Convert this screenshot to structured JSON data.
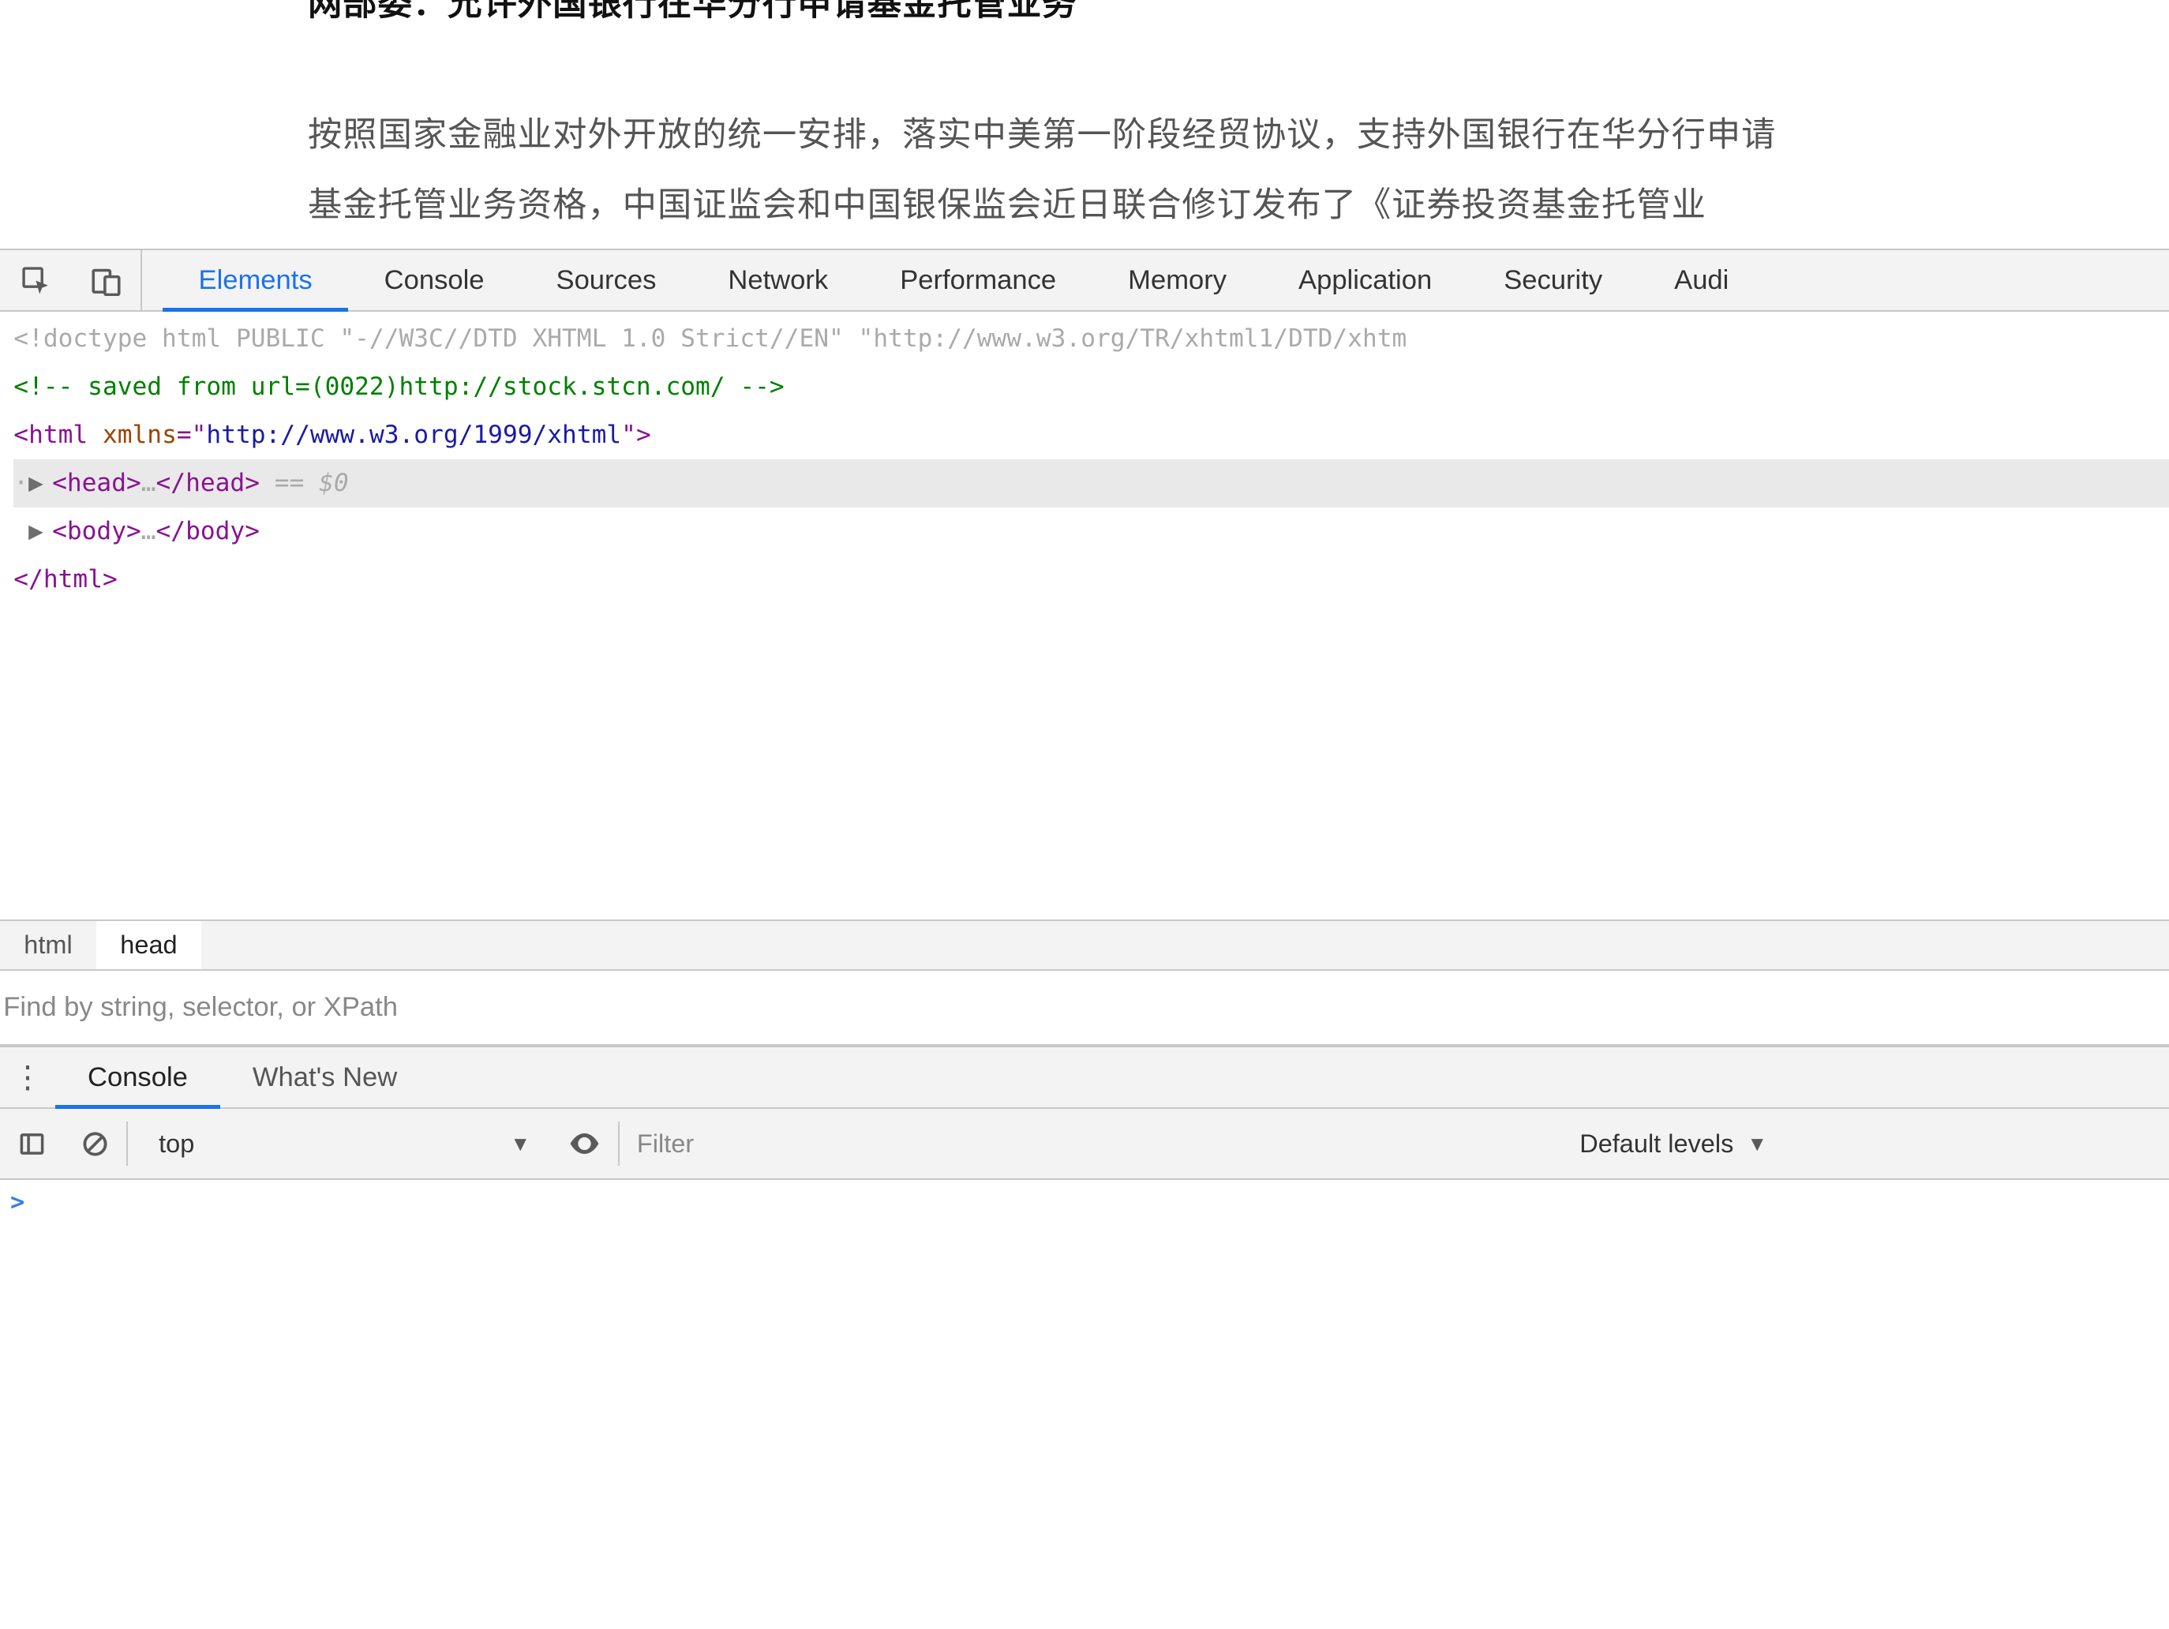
{
  "page": {
    "title": "网部委：允许外国银行在华分行申请基金托管业务",
    "body_line1": "按照国家金融业对外开放的统一安排，落实中美第一阶段经贸协议，支持外国银行在华分行申请",
    "body_line2": "基金托管业务资格，中国证监会和中国银保监会近日联合修订发布了《证券投资基金托管业"
  },
  "devtools": {
    "tabs": {
      "elements": "Elements",
      "console": "Console",
      "sources": "Sources",
      "network": "Network",
      "performance": "Performance",
      "memory": "Memory",
      "application": "Application",
      "security": "Security",
      "audits": "Audi"
    },
    "dom": {
      "doctype": "<!doctype html PUBLIC \"-//W3C//DTD XHTML 1.0 Strict//EN\" \"http://www.w3.org/TR/xhtml1/DTD/xhtm",
      "comment": "<!-- saved from url=(0022)http://stock.stcn.com/ -->",
      "html_open_pre": "<",
      "html_tag": "html",
      "html_attr_name": "xmlns",
      "html_attr_val": "http://www.w3.org/1999/xhtml",
      "head_open": "<head>",
      "head_close": "</head>",
      "ellipsis": "…",
      "eq_dollar": " == ",
      "dollar0": "$0",
      "body_open": "<body>",
      "body_close": "</body>",
      "html_close": "</html>"
    },
    "breadcrumb": {
      "html": "html",
      "head": "head"
    },
    "find_placeholder": "Find by string, selector, or XPath",
    "drawer": {
      "console": "Console",
      "whatsnew": "What's New"
    },
    "console_toolbar": {
      "context": "top",
      "filter_placeholder": "Filter",
      "levels": "Default levels"
    },
    "console_prompt": ">"
  }
}
